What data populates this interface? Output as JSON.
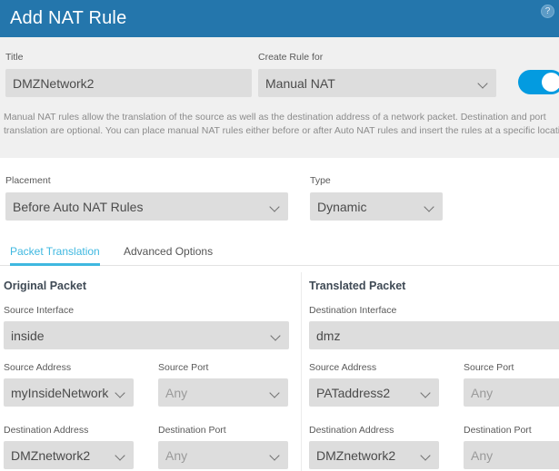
{
  "window": {
    "title": "Add NAT Rule",
    "help_icon": "help-circle-icon",
    "header_color": "#2476AC"
  },
  "form": {
    "title_label": "Title",
    "title_value": "DMZNetwork2",
    "create_rule_for_label": "Create Rule for",
    "create_rule_for_value": "Manual NAT",
    "enable_toggle_state": "on",
    "toggle_color": "#039BE0",
    "description": "Manual NAT rules allow the translation of the source as well as the destination address of a network packet. Destination and port translation are optional. You can place manual NAT rules either before or after Auto NAT rules and insert the rules at a specific location.",
    "placement_label": "Placement",
    "placement_value": "Before Auto NAT Rules",
    "type_label": "Type",
    "type_value": "Dynamic"
  },
  "tabs": [
    {
      "label": "Packet Translation",
      "active": true
    },
    {
      "label": "Advanced Options",
      "active": false
    }
  ],
  "tab_accent_color": "#3FB8E0",
  "original_packet": {
    "heading": "Original Packet",
    "source_interface_label": "Source Interface",
    "source_interface_value": "inside",
    "source_address_label": "Source Address",
    "source_address_value": "myInsideNetwork",
    "source_port_label": "Source Port",
    "source_port_value": "Any",
    "destination_address_label": "Destination Address",
    "destination_address_value": "DMZnetwork2",
    "destination_port_label": "Destination Port",
    "destination_port_value": "Any"
  },
  "translated_packet": {
    "heading": "Translated Packet",
    "destination_interface_label": "Destination Interface",
    "destination_interface_value": "dmz",
    "source_address_label": "Source Address",
    "source_address_value": "PATaddress2",
    "source_port_label": "Source Port",
    "source_port_value": "Any",
    "destination_address_label": "Destination Address",
    "destination_address_value": "DMZnetwork2",
    "destination_port_label": "Destination Port",
    "destination_port_value": "Any"
  }
}
